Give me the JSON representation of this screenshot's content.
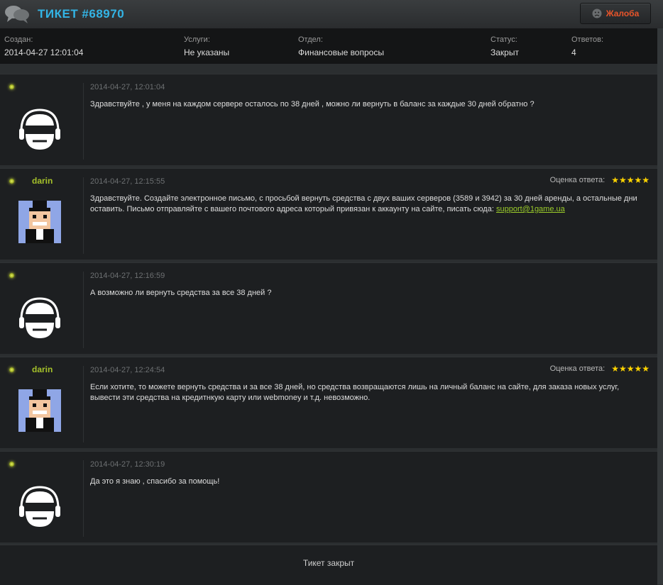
{
  "header": {
    "title": "ТИКЕТ #68970",
    "complaint_label": "Жалоба"
  },
  "info": [
    {
      "key": "Создан:",
      "value": "2014-04-27 12:01:04"
    },
    {
      "key": "Услуги:",
      "value": "Не указаны"
    },
    {
      "key": "Отдел:",
      "value": "Финансовые вопросы"
    },
    {
      "key": "Статус:",
      "value": "Закрыт"
    },
    {
      "key": "Ответов:",
      "value": "4"
    }
  ],
  "messages": [
    {
      "author": "",
      "time": "2014-04-27, 12:01:04",
      "text": "Здравствуйте , у меня на каждом сервере осталось по 38 дней , можно ли вернуть в баланс за каждые 30 дней обратно ?"
    },
    {
      "author": "darin",
      "time": "2014-04-27, 12:15:55",
      "rating_label": "Оценка ответа:",
      "stars": "★★★★★",
      "text": "Здравствуйте. Создайте электронное письмо, с просьбой вернуть средства с двух ваших серверов (3589 и 3942) за 30 дней аренды, а остальные дни оставить. Письмо отправляйте с вашего почтового адреса который привязан к аккаунту на сайте, писать сюда:",
      "link": "support@1game.ua"
    },
    {
      "author": "",
      "time": "2014-04-27, 12:16:59",
      "text": "А возможно ли вернуть средства за все 38 дней ?"
    },
    {
      "author": "darin",
      "time": "2014-04-27, 12:24:54",
      "rating_label": "Оценка ответа:",
      "stars": "★★★★★",
      "text": "Если хотите, то можете вернуть средства и за все 38 дней, но средства возвращаются лишь на личный баланс на сайте, для заказа новых услуг, вывести эти средства на кредитнкую карту или webmoney и т.д. невозможно."
    },
    {
      "author": "",
      "time": "2014-04-27, 12:30:19",
      "text": "Да это я знаю , спасибо за помощь!"
    }
  ],
  "footer": {
    "status_text": "Тикет закрыт"
  },
  "colors": {
    "title": "#33b4e5",
    "complaint": "#e8542a",
    "author": "#a5c12a",
    "link": "#9ccd2a",
    "star": "#ffd400"
  }
}
